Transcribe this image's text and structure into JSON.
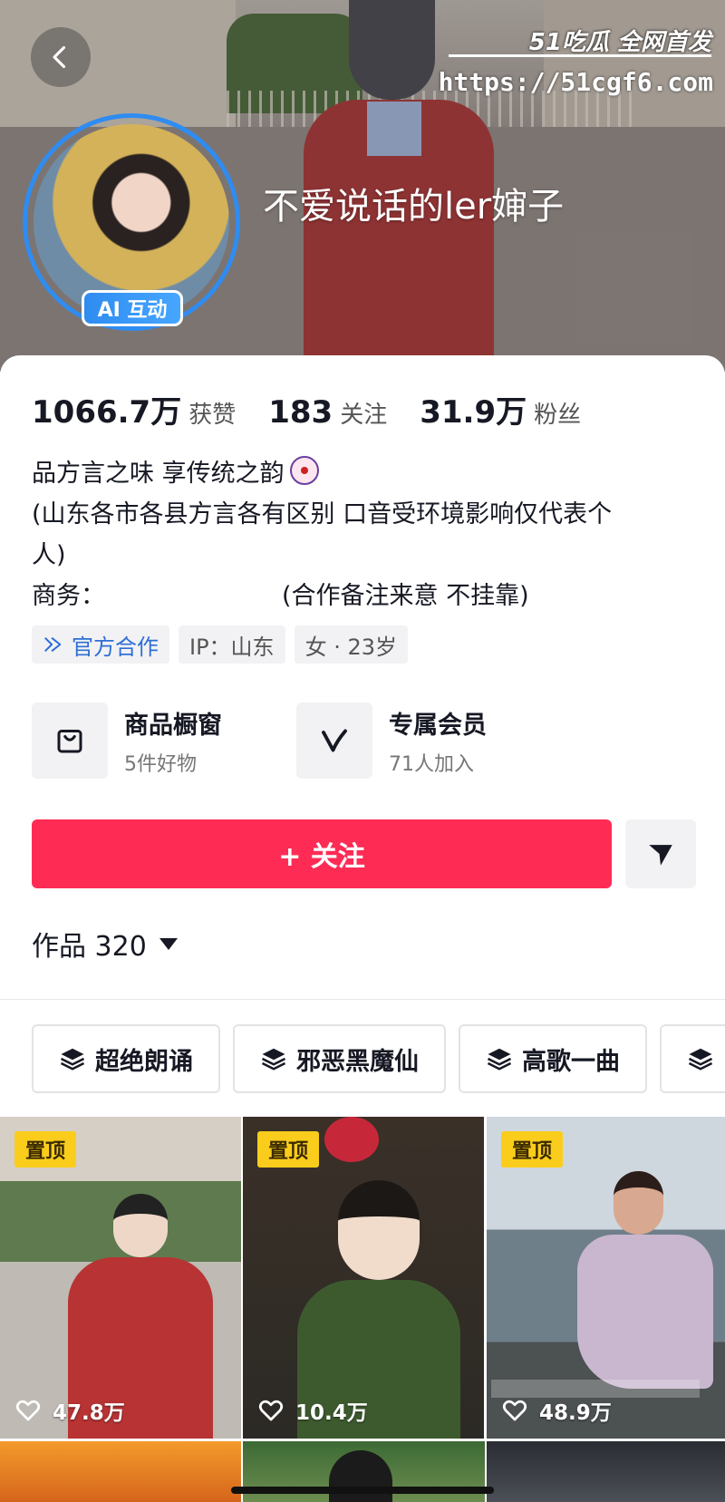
{
  "header": {
    "nickname": "不爱说话的ler婶子",
    "ai_badge": "AI 互动",
    "watermark": {
      "brand": "51吃瓜 全网首发",
      "url": "https://51cgf6.com"
    }
  },
  "stats": [
    {
      "value": "1066.7万",
      "label": "获赞"
    },
    {
      "value": "183",
      "label": "关注"
    },
    {
      "value": "31.9万",
      "label": "粉丝"
    }
  ],
  "bio": {
    "line1": "品方言之味 享传统之韵",
    "line2": "(山东各市各县方言各有区别 口音受环境影响仅代表个",
    "line3": "人)",
    "line4_prefix": "商务：",
    "line4_suffix": "(合作备注来意  不挂靠)"
  },
  "tags": {
    "official": "官方合作",
    "ip": "IP：山东",
    "gender_age": "女 · 23岁"
  },
  "services": [
    {
      "title": "商品橱窗",
      "sub": "5件好物",
      "icon": "shopping-bag-icon"
    },
    {
      "title": "专属会员",
      "sub": "71人加入",
      "icon": "vip-v-icon"
    }
  ],
  "actions": {
    "follow": "+ 关注"
  },
  "works": {
    "label": "作品 320"
  },
  "collections": [
    "超绝朗诵",
    "邪恶黑魔仙",
    "高歌一曲"
  ],
  "grid": [
    {
      "pin": "置顶",
      "likes": "47.8万"
    },
    {
      "pin": "置顶",
      "likes": "10.4万"
    },
    {
      "pin": "置顶",
      "likes": "48.9万"
    }
  ],
  "colors": {
    "accent": "#fe2c55",
    "badge": "#2f8cf0",
    "pin": "#facd1c"
  }
}
